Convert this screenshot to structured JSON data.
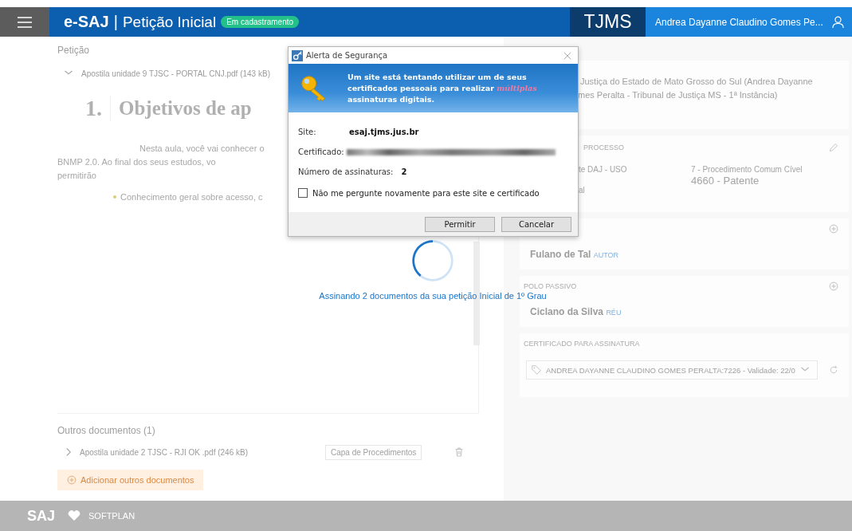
{
  "header": {
    "brand": "e-SAJ",
    "separator": "|",
    "title": "Petição Inicial",
    "status_badge": "Em cadastramento",
    "court": "TJMS",
    "user": "Andrea Dayanne Claudino Gomes Pe..."
  },
  "petition": {
    "label": "Petição",
    "document": {
      "name": "Apostila unidade 9 TJSC - PORTAL CNJ.pdf (143 kB)",
      "expanded": true
    },
    "preview": {
      "heading_number": "1.",
      "heading": "Objetivos de ap",
      "paragraph_lines": [
        "Nesta aula, você vai conhecer o",
        "BNMP 2.0. Ao final dos seus estudos, vo",
        "permitirão"
      ],
      "bullet": "Conhecimento geral sobre acesso, c"
    }
  },
  "other_documents": {
    "label": "Outros documentos (1)",
    "items": [
      {
        "name": "Apostila unidade 2 TJSC - RJI OK .pdf (246 kB)",
        "expanded": false,
        "type": "Capa de Procedimentos"
      }
    ],
    "add_button": "Adicionar outros documentos"
  },
  "side_panel": {
    "title_lines": [
      "Justiça do Estado de Mato Grosso do Sul (Andrea Dayanne",
      "mes Peralta - Tribunal de Justiça MS - 1ª Instância)"
    ],
    "process": {
      "label": "PROCESSO",
      "fields": [
        [
          "te DAJ - USO",
          "al"
        ],
        [
          "7 - Procedimento Comum Cível",
          "4660 - Patente"
        ]
      ]
    },
    "parties": [
      {
        "name": "Fulano de Tal",
        "role": "AUTOR"
      },
      {
        "label": "POLO PASSIVO",
        "name": "Ciclano da Silva",
        "role": "RÉU"
      }
    ],
    "certificate": {
      "label": "CERTIFICADO PARA ASSINATURA",
      "value": "ANDREA DAYANNE CLAUDINO GOMES PERALTA:7226 - Validade: 22/0"
    }
  },
  "progress": {
    "message": "Assinando 2 documentos da sua petição Inicial de 1º Grau"
  },
  "dialog": {
    "title": "Alerta de Segurança",
    "banner": "Um site está tentando utilizar um de seus certificados pessoais para realizar *múltiplas* assinaturas digitais.",
    "rows": [
      {
        "kind": "text",
        "label": "Site:",
        "value": "esaj.tjms.jus.br"
      },
      {
        "kind": "redacted",
        "label": "Certificado:"
      },
      {
        "kind": "text",
        "label": "Número de assinaturas:",
        "value": "2"
      }
    ],
    "checkbox": {
      "label": "Não me pergunte novamente para este site e certificado",
      "checked": false
    },
    "buttons": [
      "Permitir",
      "Cancelar"
    ]
  },
  "footer": {
    "logo": "SAJ",
    "brand": "SOFTPLAN"
  }
}
